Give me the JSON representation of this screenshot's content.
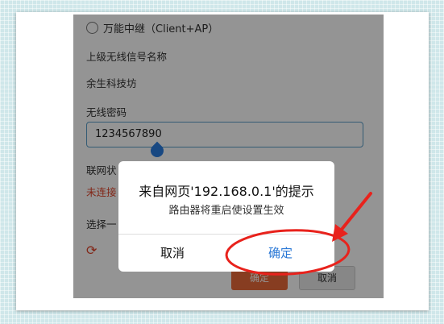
{
  "form": {
    "mode_option": "万能中继（Client+AP）",
    "upstream_ssid_label": "上级无线信号名称",
    "upstream_ssid_value": "余生科技坊",
    "password_label": "无线密码",
    "password_value": "1234567890",
    "status_label": "联网状",
    "status_value": "未连接",
    "select_label": "选择一",
    "refresh_icon": "refresh-icon",
    "confirm_label": "确定",
    "cancel_label": "取消"
  },
  "dialog": {
    "title": "来自网页'192.168.0.1'的提示",
    "message": "路由器将重启使设置生效",
    "cancel_label": "取消",
    "ok_label": "确定"
  },
  "annotation": {
    "color": "#e8221c"
  }
}
